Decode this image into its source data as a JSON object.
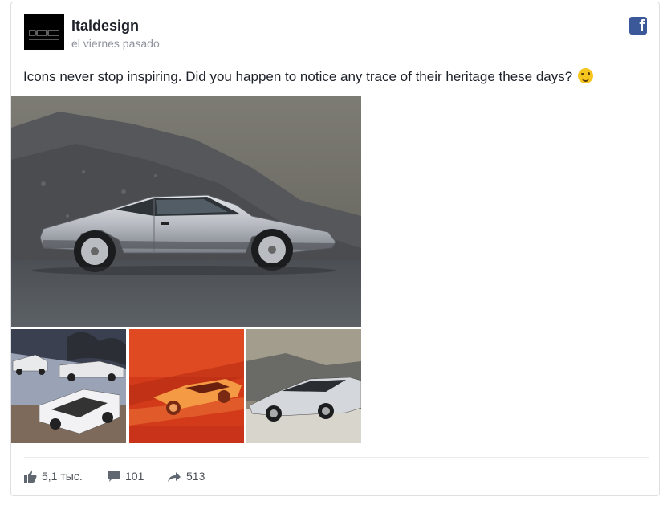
{
  "post": {
    "author": "Italdesign",
    "timestamp": "el viernes pasado",
    "text": "Icons never stop inspiring. Did you happen to notice any trace of their heritage these days?",
    "emoji": "winking-face-emoji",
    "platform_icon": "facebook-icon",
    "brand_color": "#3b5998"
  },
  "images": {
    "main": "silver-wedge-sports-car-on-gravel",
    "thumbnails": [
      "sports-cars-sketch",
      "orange-car-speed-painting",
      "silver-sports-car-quarry"
    ]
  },
  "stats": {
    "likes": "5,1 тыс.",
    "comments": "101",
    "shares": "513"
  }
}
